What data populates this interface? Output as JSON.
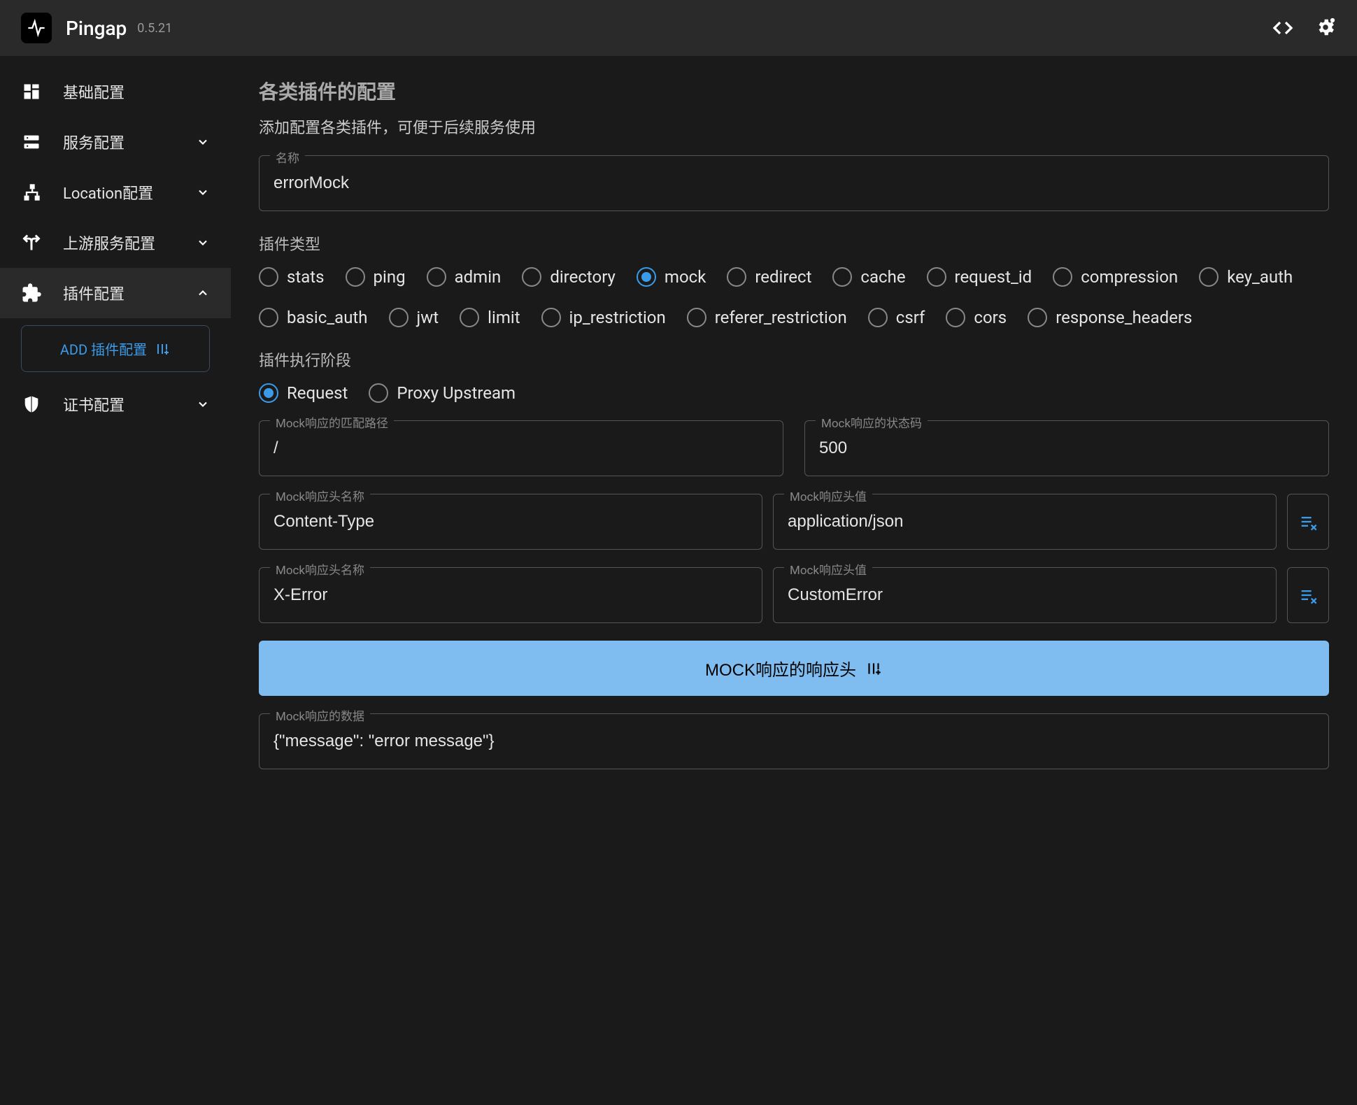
{
  "header": {
    "app_name": "Pingap",
    "version": "0.5.21"
  },
  "sidebar": {
    "items": [
      {
        "label": "基础配置",
        "expandable": false
      },
      {
        "label": "服务配置",
        "expandable": true
      },
      {
        "label": "Location配置",
        "expandable": true
      },
      {
        "label": "上游服务配置",
        "expandable": true
      },
      {
        "label": "插件配置",
        "expandable": true,
        "active": true
      },
      {
        "label": "证书配置",
        "expandable": true
      }
    ],
    "add_button": "ADD 插件配置"
  },
  "main": {
    "title": "各类插件的配置",
    "subtitle": "添加配置各类插件，可便于后续服务使用",
    "name_label": "名称",
    "name_value": "errorMock",
    "plugin_type_label": "插件类型",
    "plugin_types": [
      "stats",
      "ping",
      "admin",
      "directory",
      "mock",
      "redirect",
      "cache",
      "request_id",
      "compression",
      "key_auth",
      "basic_auth",
      "jwt",
      "limit",
      "ip_restriction",
      "referer_restriction",
      "csrf",
      "cors",
      "response_headers"
    ],
    "plugin_type_selected": "mock",
    "exec_stage_label": "插件执行阶段",
    "exec_stages": [
      "Request",
      "Proxy Upstream"
    ],
    "exec_stage_selected": "Request",
    "path_label": "Mock响应的匹配路径",
    "path_value": "/",
    "status_label": "Mock响应的状态码",
    "status_value": "500",
    "header_name_label": "Mock响应头名称",
    "header_value_label": "Mock响应头值",
    "headers": [
      {
        "name": "Content-Type",
        "value": "application/json"
      },
      {
        "name": "X-Error",
        "value": "CustomError"
      }
    ],
    "mock_headers_button": "MOCK响应的响应头",
    "data_label": "Mock响应的数据",
    "data_value": "{\"message\": \"error message\"}"
  }
}
